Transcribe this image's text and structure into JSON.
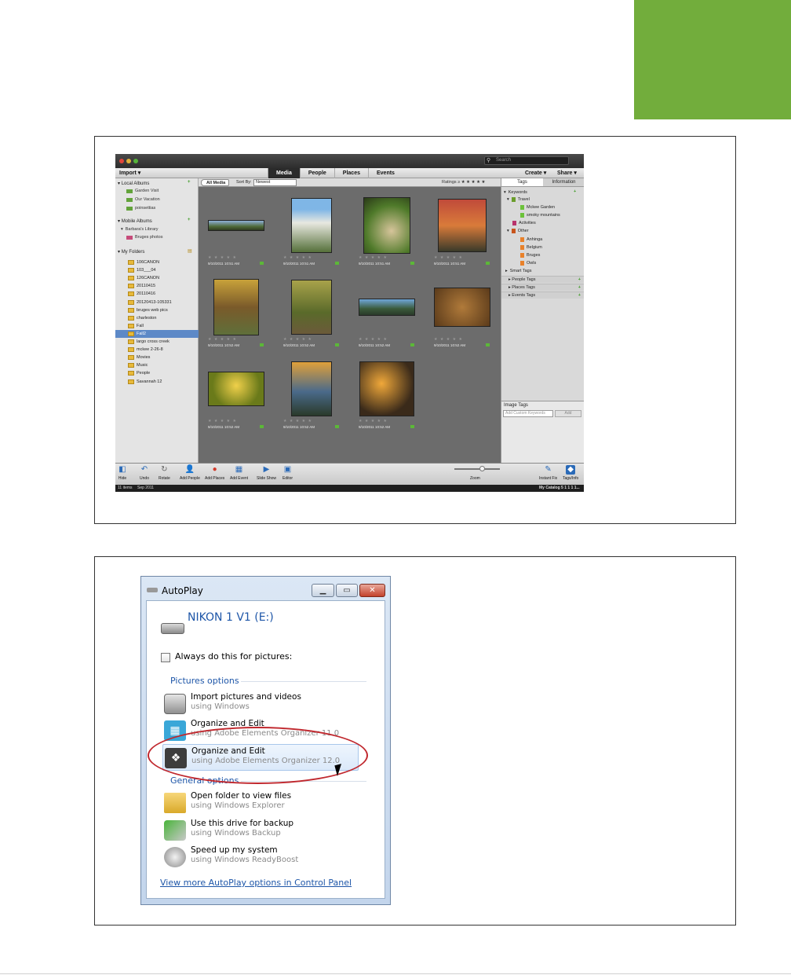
{
  "organizer": {
    "search_placeholder": "Search",
    "menu": {
      "import": "Import",
      "create": "Create",
      "share": "Share"
    },
    "tabs": [
      "Media",
      "People",
      "Places",
      "Events"
    ],
    "left": {
      "local_albums": "Local Albums",
      "albums": [
        "Garden Visit",
        "Our Vacation",
        "poinsettias"
      ],
      "mobile_albums": "Mobile Albums",
      "library": "Barbara's Library",
      "library_item": "Bruges photos",
      "my_folders": "My Folders",
      "folders": [
        "106CANON",
        "103___04",
        "126CANON",
        "20110415",
        "20110416",
        "20120413-105331",
        "bruges web pics",
        "charleston",
        "Fall",
        "Fall2",
        "largo cross creek",
        "mckee 2-26-8",
        "Movies",
        "Music",
        "People",
        "Savannah 12"
      ],
      "selected_folder": "Fall2"
    },
    "center": {
      "all_media": "All Media",
      "sort_by": "Sort By:",
      "sort_value": "Newest",
      "ratings": "Ratings ≥ ★ ★ ★ ★ ★",
      "stars": "★ ★ ★ ★ ★",
      "dates": [
        "9/10/2011 10:51 AM",
        "9/10/2011 10:51 AM",
        "9/10/2011 10:51 AM",
        "9/10/2011 10:51 AM",
        "9/10/2011 10:52 AM",
        "9/10/2011 10:52 AM",
        "9/10/2011 10:52 AM",
        "9/10/2011 10:52 AM",
        "9/10/2011 10:52 AM",
        "9/10/2011 10:52 AM",
        "9/10/2011 10:52 AM"
      ]
    },
    "right": {
      "tabs": [
        "Tags",
        "Information"
      ],
      "keywords": "Keywords",
      "travel": "Travel",
      "travel_items": [
        "Mckee Garden",
        "smoky mountains"
      ],
      "activities": "Activities",
      "other": "Other",
      "other_items": [
        "Anhinga",
        "Belgium",
        "Bruges",
        "Owls"
      ],
      "smart_tags": "Smart Tags",
      "people_tags": "People Tags",
      "places_tags": "Places Tags",
      "events_tags": "Events Tags",
      "image_tags": "Image Tags",
      "custom_placeholder": "Add Custom Keywords",
      "add": "Add"
    },
    "toolbar": [
      "Hide",
      "Undo",
      "Rotate",
      "Add People",
      "Add Places",
      "Add Event",
      "Slide Show",
      "Editor"
    ],
    "zoom": "Zoom",
    "instant_fix": "Instant Fix",
    "tags_info": "Tags/Info",
    "status_left": "11 items",
    "status_date": "Sep 2011",
    "status_right": "My Catalog 5 1 1 1 1..."
  },
  "autoplay": {
    "title": "AutoPlay",
    "device": "NIKON 1 V1 (E:)",
    "always": "Always do this for pictures:",
    "pictures_options": "Pictures options",
    "general_options": "General options",
    "options": [
      {
        "title": "Import pictures and videos",
        "sub": "using Windows"
      },
      {
        "title": "Organize and Edit",
        "sub": "using Adobe Elements Organizer 11.0"
      },
      {
        "title": "Organize and Edit",
        "sub": "using Adobe Elements Organizer 12.0"
      },
      {
        "title": "Open folder to view files",
        "sub": "using Windows Explorer"
      },
      {
        "title": "Use this drive for backup",
        "sub": "using Windows Backup"
      },
      {
        "title": "Speed up my system",
        "sub": "using Windows ReadyBoost"
      }
    ],
    "link": "View more AutoPlay options in Control Panel"
  }
}
